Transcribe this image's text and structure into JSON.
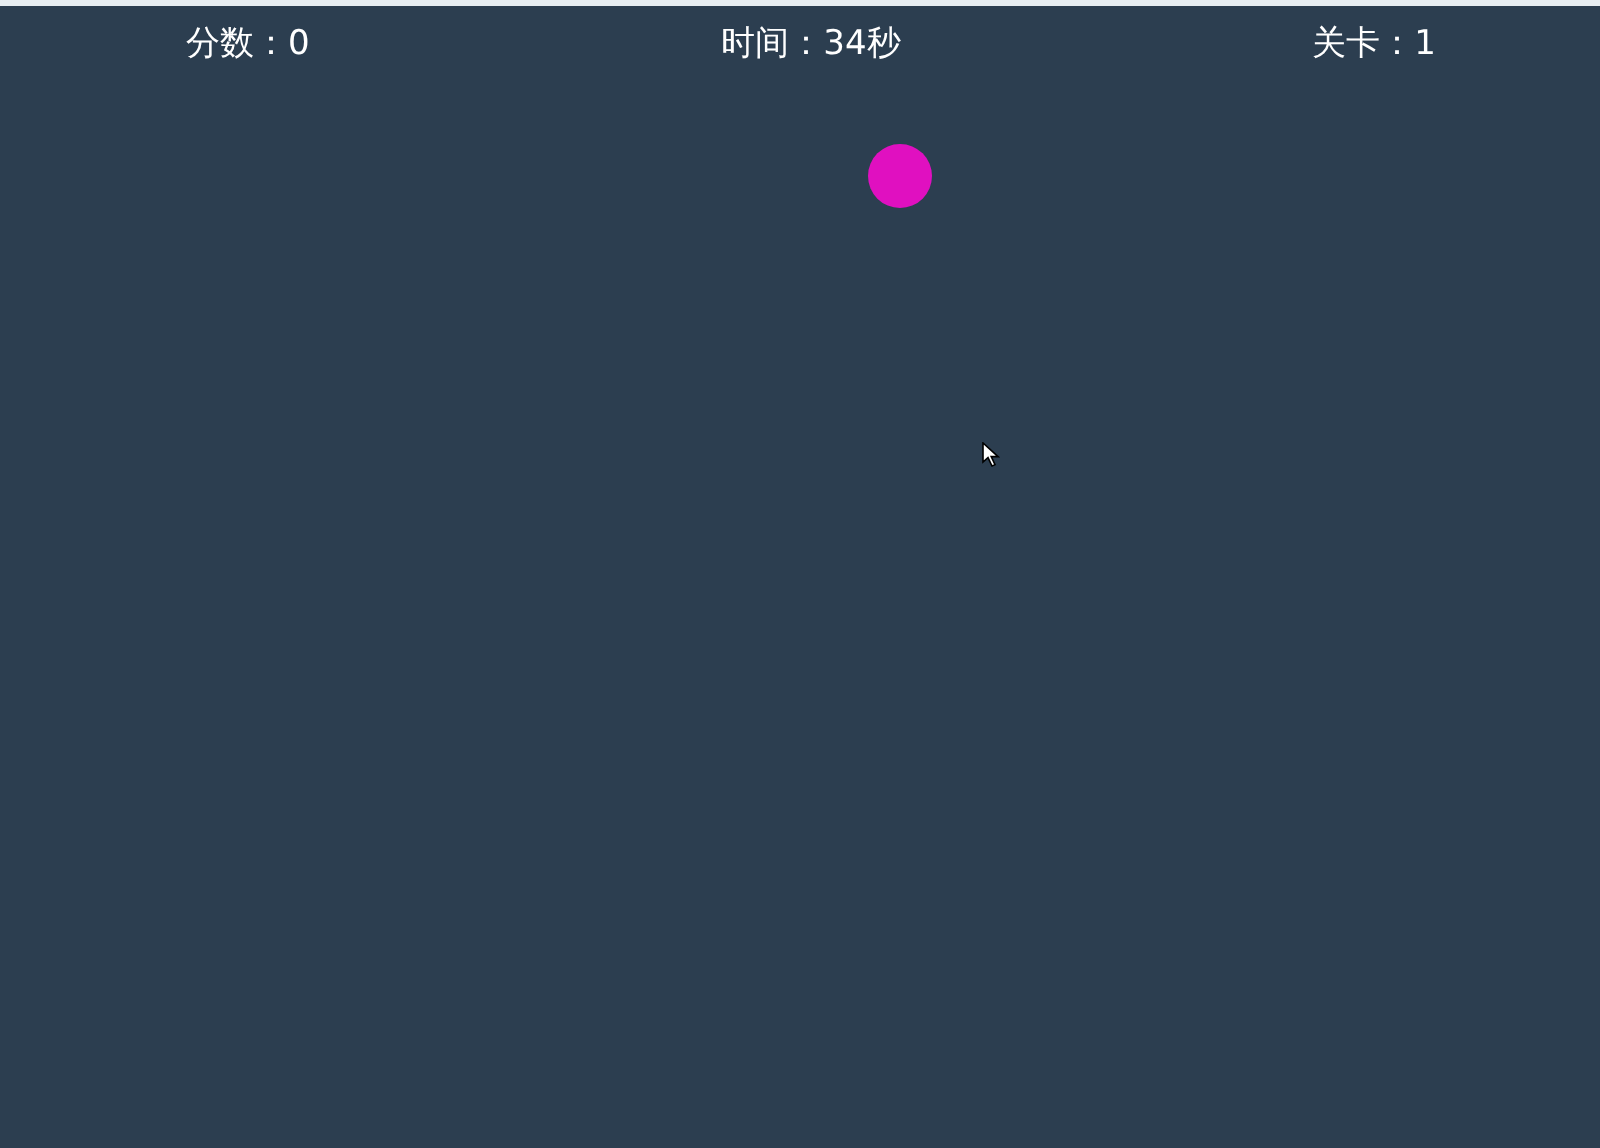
{
  "hud": [
    {
      "label": "分数：0"
    },
    {
      "label": "时间：34秒"
    },
    {
      "label": "关卡：1"
    }
  ]
}
